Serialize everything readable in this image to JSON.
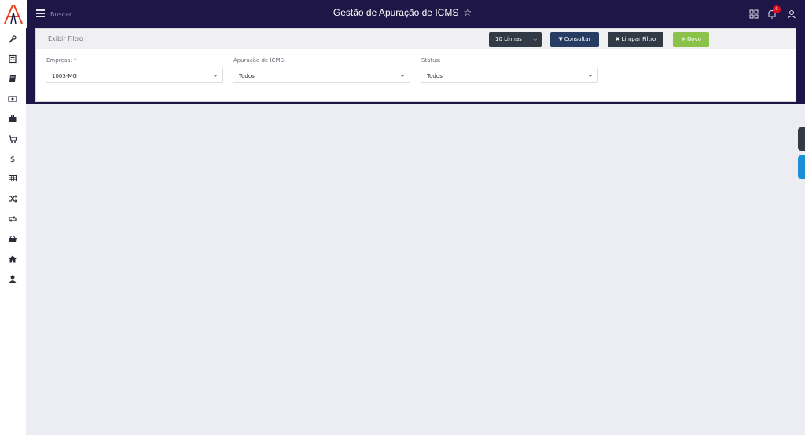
{
  "topbar": {
    "search_placeholder": "Buscar...",
    "title": "Gestão de Apuração de ICMS",
    "notification_count": "0"
  },
  "filter": {
    "header_title": "Exibir Filtro",
    "lines_label": "10 Linhas",
    "consultar_label": "Consultar",
    "limpar_label": "Limpar Filtro",
    "novo_label": "Novo",
    "fields": [
      {
        "label": "Empresa:",
        "required_mark": "*",
        "value": "1003-MG"
      },
      {
        "label": "Apuração de ICMS:",
        "value": "Todos"
      },
      {
        "label": "Status:",
        "value": "Todos"
      }
    ]
  },
  "sidebar": {
    "items": [
      {
        "icon": "wrench-icon"
      },
      {
        "icon": "calculator-icon"
      },
      {
        "icon": "book-icon"
      },
      {
        "icon": "money-icon"
      },
      {
        "icon": "briefcase-icon"
      },
      {
        "icon": "cart-icon"
      },
      {
        "icon": "dollar-icon"
      },
      {
        "icon": "table-icon"
      },
      {
        "icon": "shuffle-icon"
      },
      {
        "icon": "retweet-icon"
      },
      {
        "icon": "basket-icon"
      },
      {
        "icon": "home-icon"
      },
      {
        "icon": "user-icon"
      }
    ]
  },
  "colors": {
    "topbar_bg": "#1e1646",
    "accent_orange": "#e8401c",
    "btn_dark": "#323a45",
    "btn_navy": "#273c63",
    "btn_green": "#8bc34a",
    "badge_red": "#e01020",
    "edge_tab_blue": "#1a8fd8"
  }
}
